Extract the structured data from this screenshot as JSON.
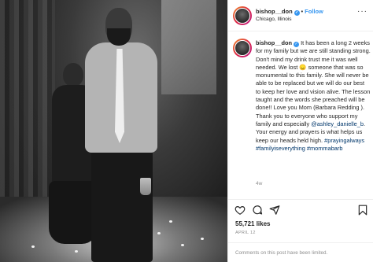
{
  "post": {
    "username": "bishop__don",
    "verified": true,
    "dot": "•",
    "follow_label": "Follow",
    "location": "Chicago, Illinois",
    "more_icon": "more-horizontal-icon"
  },
  "caption": {
    "username": "bishop__don",
    "text_1": "It has been a long 2 weeks for my family but we are still standing strong. Don't mind my drink trust me it was well needed. We lost 😞 someone that was so monumental to this family. She will never be able to be replaced but we will do our best to keep her love and vision alive. The lesson taught and the words she preached will be done!! Love you Mom (Barbara Redding ). Thank you to everyone who support my family and especially ",
    "mention": "@ashley_danielle_b",
    "text_2": ". Your energy and prayers is what helps us keep our heads held high.",
    "hashtags": "#prayingalways #familyiseverything #mommabarb",
    "age": "4w"
  },
  "actions": {
    "icons": [
      "heart-icon",
      "comment-icon",
      "share-icon",
      "bookmark-icon"
    ]
  },
  "likes": "55,721 likes",
  "date": "APRIL 12",
  "comments_notice": "Comments on this post have been limited."
}
